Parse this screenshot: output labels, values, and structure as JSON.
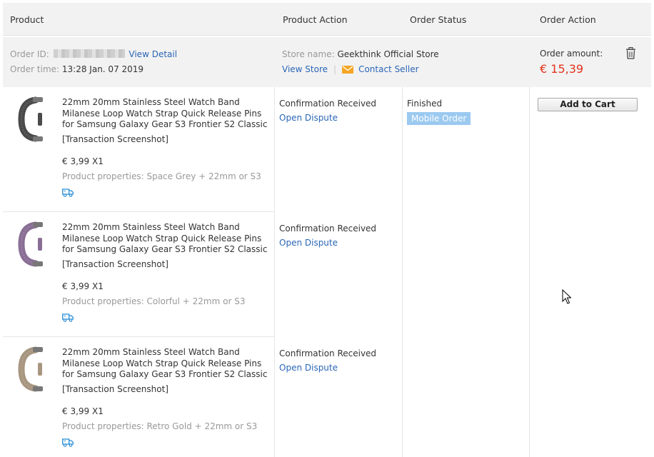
{
  "header": {
    "product": "Product",
    "product_action": "Product Action",
    "order_status": "Order Status",
    "order_action": "Order Action"
  },
  "order": {
    "id_label": "Order ID:",
    "view_detail": "View Detail",
    "time_label": "Order time:",
    "time_value": "13:28 Jan. 07 2019",
    "store_label": "Store name:",
    "store_value": "Geekthink Official Store",
    "view_store": "View Store",
    "separator": "|",
    "contact_seller": "Contact Seller",
    "amount_label": "Order amount:",
    "amount_value": "€ 15,39",
    "status": "Finished",
    "badge": "Mobile Order",
    "add_to_cart": "Add to Cart"
  },
  "items": [
    {
      "title": "22mm 20mm Stainless Steel Watch Band Milanese Loop Watch Strap Quick Release Pins for Samsung Galaxy Gear S3 Frontier S2 Classic",
      "screenshot": "[Transaction Screenshot]",
      "price": "€ 3,99 X1",
      "properties": "Product properties: Space Grey + 22mm or S3",
      "action_status": "Confirmation Received",
      "dispute": "Open Dispute",
      "band_color": "#4a4a4a"
    },
    {
      "title": "22mm 20mm Stainless Steel Watch Band Milanese Loop Watch Strap Quick Release Pins for Samsung Galaxy Gear S3 Frontier S2 Classic",
      "screenshot": "[Transaction Screenshot]",
      "price": "€ 3,99 X1",
      "properties": "Product properties: Colorful + 22mm or S3",
      "action_status": "Confirmation Received",
      "dispute": "Open Dispute",
      "band_color": "#8a6f95"
    },
    {
      "title": "22mm 20mm Stainless Steel Watch Band Milanese Loop Watch Strap Quick Release Pins for Samsung Galaxy Gear S3 Frontier S2 Classic",
      "screenshot": "[Transaction Screenshot]",
      "price": "€ 3,99 X1",
      "properties": "Product properties: Retro Gold + 22mm or S3",
      "action_status": "Confirmation Received",
      "dispute": "Open Dispute",
      "band_color": "#a89680"
    }
  ],
  "colors": {
    "link": "#2a66b6",
    "amount": "#e2341d",
    "badge": "#9bc9f0",
    "mail_icon": "#f5a623",
    "truck_icon": "#2a8fd6"
  }
}
